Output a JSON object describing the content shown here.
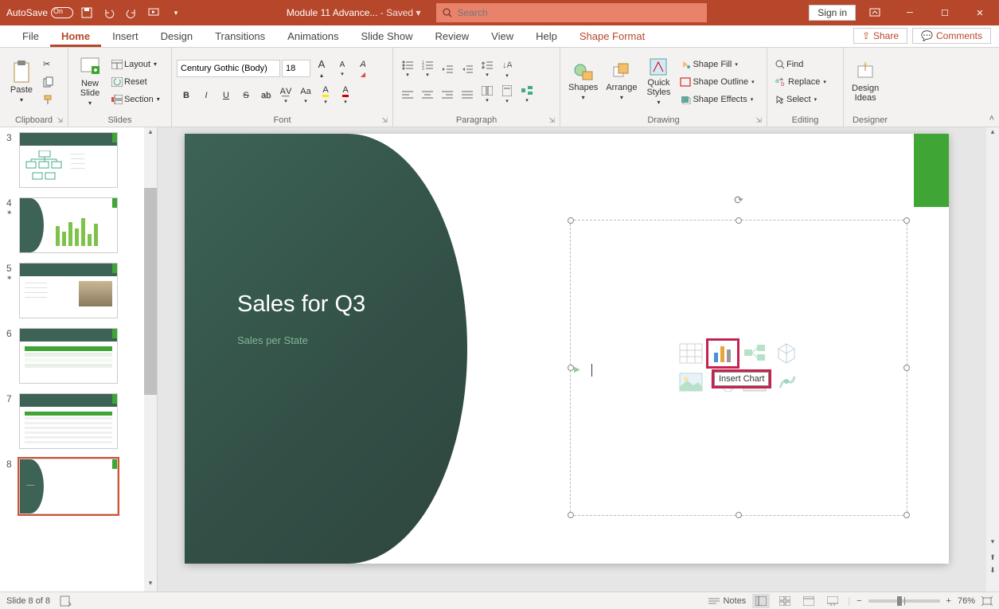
{
  "titlebar": {
    "autosave_label": "AutoSave",
    "doc_title": "Module 11 Advance...",
    "saved_state": "- Saved ▾",
    "search_placeholder": "Search",
    "signin": "Sign in"
  },
  "tabs": {
    "items": [
      "File",
      "Home",
      "Insert",
      "Design",
      "Transitions",
      "Animations",
      "Slide Show",
      "Review",
      "View",
      "Help",
      "Shape Format"
    ],
    "active": "Home",
    "share": "Share",
    "comments": "Comments"
  },
  "ribbon": {
    "clipboard": {
      "label": "Clipboard",
      "paste": "Paste"
    },
    "slides": {
      "label": "Slides",
      "new_slide": "New\nSlide",
      "layout": "Layout",
      "reset": "Reset",
      "section": "Section"
    },
    "font": {
      "label": "Font",
      "name": "Century Gothic (Body)",
      "size": "18"
    },
    "paragraph": {
      "label": "Paragraph"
    },
    "drawing": {
      "label": "Drawing",
      "shapes": "Shapes",
      "arrange": "Arrange",
      "quick_styles": "Quick\nStyles",
      "shape_fill": "Shape Fill",
      "shape_outline": "Shape Outline",
      "shape_effects": "Shape Effects"
    },
    "editing": {
      "label": "Editing",
      "find": "Find",
      "replace": "Replace",
      "select": "Select"
    },
    "designer": {
      "label": "Designer",
      "design_ideas": "Design\nIdeas"
    }
  },
  "thumbs": [
    {
      "num": "3",
      "star": false
    },
    {
      "num": "4",
      "star": true
    },
    {
      "num": "5",
      "star": true
    },
    {
      "num": "6",
      "star": false
    },
    {
      "num": "7",
      "star": false
    },
    {
      "num": "8",
      "star": false
    }
  ],
  "slide": {
    "title": "Sales for Q3",
    "subtitle": "Sales per State",
    "tooltip": "Insert Chart"
  },
  "content_icons": [
    "table-icon",
    "chart-icon",
    "smartart-icon",
    "3d-icon",
    "picture-icon",
    "online-picture-icon",
    "video-icon",
    "stock-icon"
  ],
  "status": {
    "slide_info": "Slide 8 of 8",
    "notes": "Notes",
    "zoom": "76%"
  }
}
